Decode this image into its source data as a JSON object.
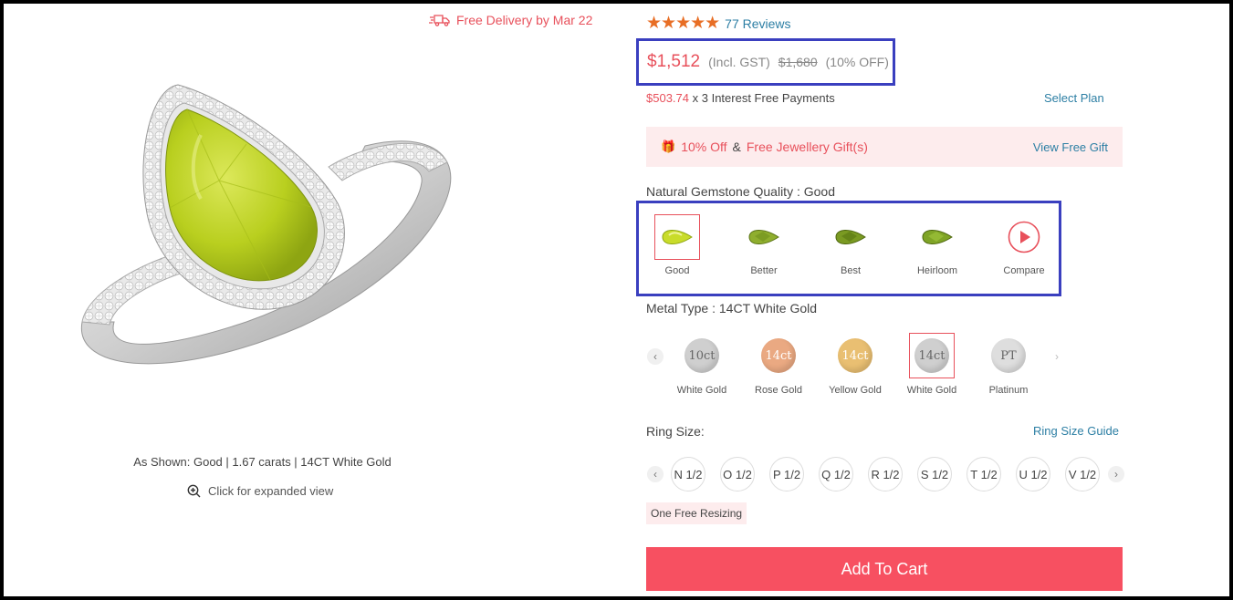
{
  "delivery": {
    "text": "Free Delivery by Mar 22",
    "icon": "truck-icon"
  },
  "product": {
    "caption": "As Shown: Good | 1.67 carats | 14CT White Gold",
    "expand_label": "Click for expanded view"
  },
  "rating": {
    "stars": "★★★★★",
    "reviews": "77 Reviews"
  },
  "price": {
    "current": "$1,512",
    "incl": "(Incl. GST)",
    "original": "$1,680",
    "discount": "(10% OFF)"
  },
  "installments": {
    "amount": "$503.74",
    "text": "x 3 Interest Free Payments",
    "select_plan": "Select Plan"
  },
  "gift": {
    "off": "10% Off",
    "amp": "&",
    "gift_text": "Free Jewellery Gift(s)",
    "view": "View Free Gift"
  },
  "quality": {
    "label": "Natural Gemstone Quality : Good",
    "options": [
      "Good",
      "Better",
      "Best",
      "Heirloom",
      "Compare"
    ],
    "selected": "Good"
  },
  "metal": {
    "label": "Metal Type : 14CT White Gold",
    "options": [
      {
        "badge": "10ct",
        "name": "White Gold",
        "color": "#c9c9c9"
      },
      {
        "badge": "14ct",
        "name": "Rose Gold",
        "color": "#e8a27a"
      },
      {
        "badge": "14ct",
        "name": "Yellow Gold",
        "color": "#e6b86a"
      },
      {
        "badge": "14ct",
        "name": "White Gold",
        "color": "#c9c9c9"
      },
      {
        "badge": "PT",
        "name": "Platinum",
        "color": "#d6d6d6"
      }
    ],
    "selected_index": 3
  },
  "ring_size": {
    "label": "Ring Size:",
    "guide": "Ring Size Guide",
    "sizes": [
      "N 1/2",
      "O 1/2",
      "P 1/2",
      "Q 1/2",
      "R 1/2",
      "S 1/2",
      "T 1/2",
      "U 1/2",
      "V 1/2"
    ],
    "free_resizing": "One Free Resizing"
  },
  "cart": {
    "label": "Add To Cart"
  },
  "colors": {
    "accent": "#e8505b",
    "link": "#2d7fa4",
    "highlight_box": "#3a3fbf",
    "star": "#e86e25"
  }
}
